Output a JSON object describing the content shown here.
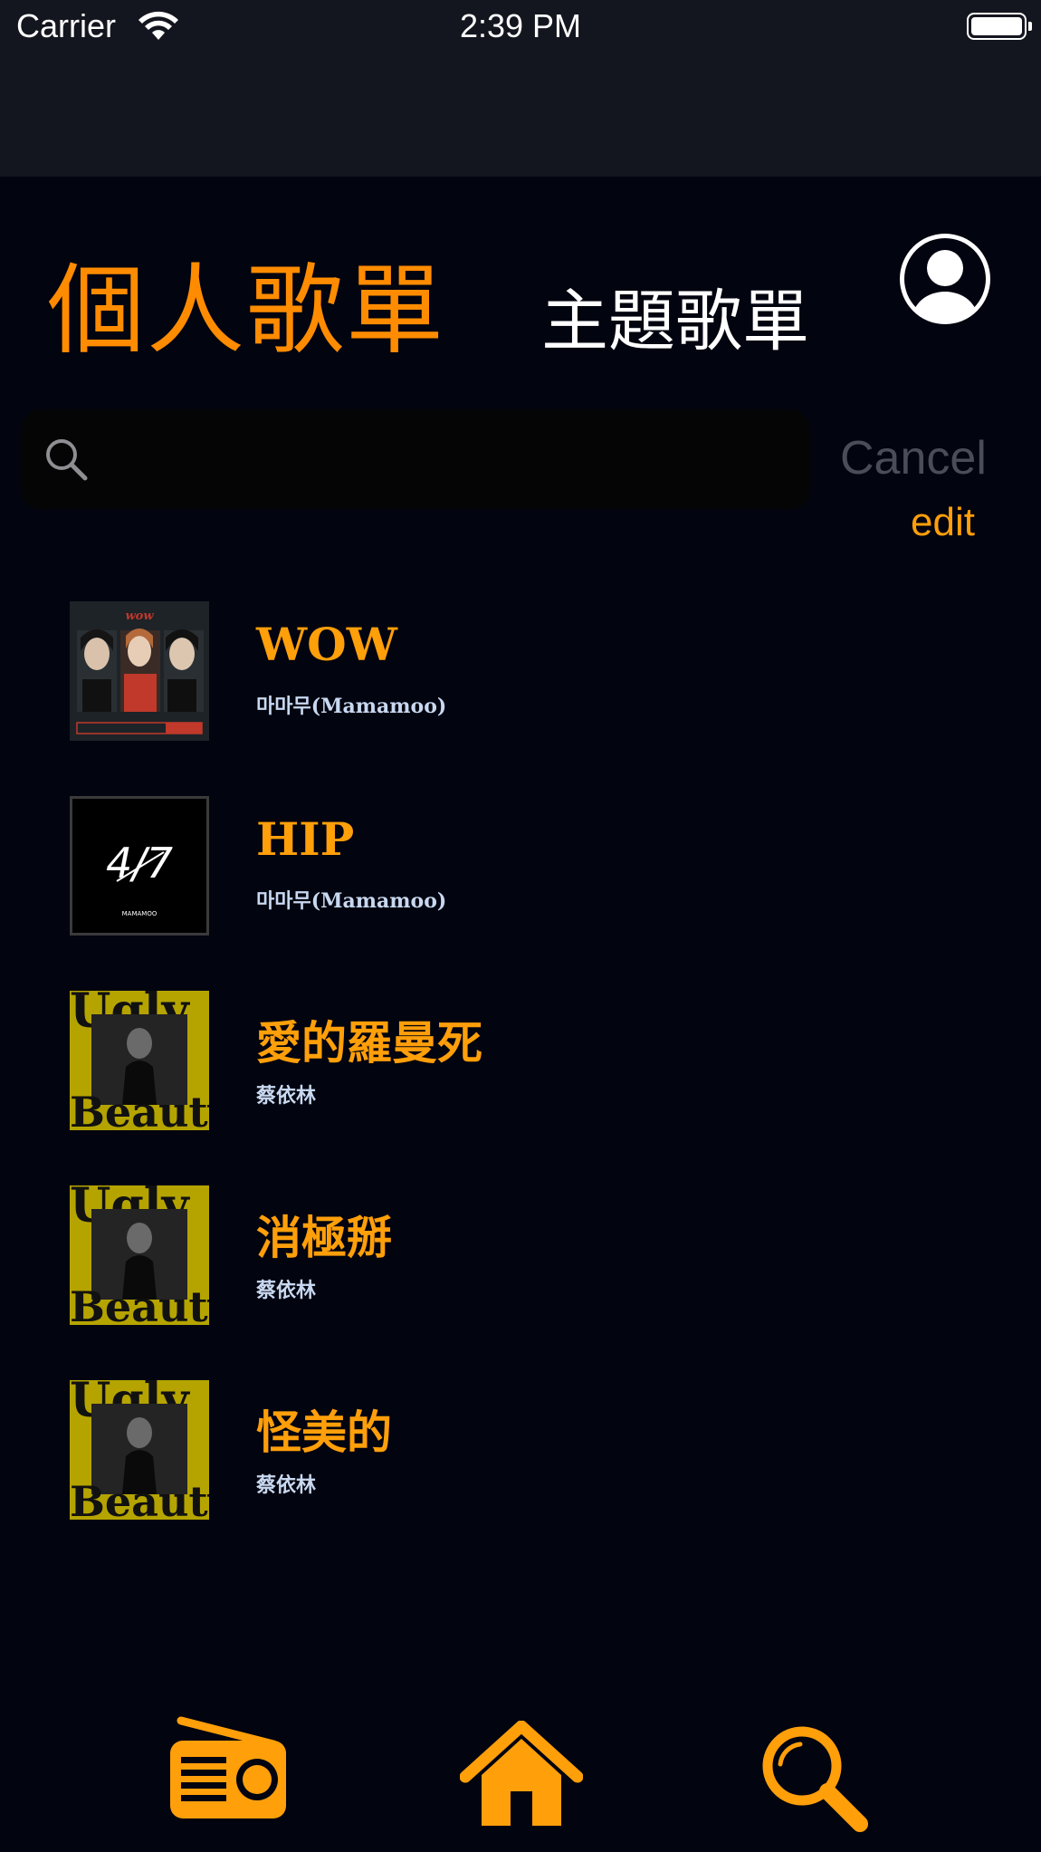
{
  "status_bar": {
    "carrier": "Carrier",
    "time": "2:39 PM"
  },
  "header": {
    "tab_personal": "個人歌單",
    "tab_theme": "主題歌單",
    "profile_icon": "person-circle-icon"
  },
  "search": {
    "placeholder": "",
    "value": "",
    "cancel_label": "Cancel",
    "edit_label": "edit"
  },
  "songs": [
    {
      "title": "WOW",
      "artist": "마마무(Mamamoo)",
      "cover": "wow-album-cover"
    },
    {
      "title": "HIP",
      "artist": "마마무(Mamamoo)",
      "cover": "hip-album-cover"
    },
    {
      "title": "愛的羅曼死",
      "artist": "蔡依林",
      "cover": "ugly-beauty-album-cover"
    },
    {
      "title": "消極掰",
      "artist": "蔡依林",
      "cover": "ugly-beauty-album-cover"
    },
    {
      "title": "怪美的",
      "artist": "蔡依林",
      "cover": "ugly-beauty-album-cover"
    }
  ],
  "tab_bar": {
    "items": [
      {
        "icon": "radio-icon"
      },
      {
        "icon": "home-icon"
      },
      {
        "icon": "search-icon"
      }
    ]
  },
  "colors": {
    "background": "#02040f",
    "accent": "#ff9f0a",
    "header_active": "#ff8c00",
    "cover_yellow": "#b5a400"
  }
}
